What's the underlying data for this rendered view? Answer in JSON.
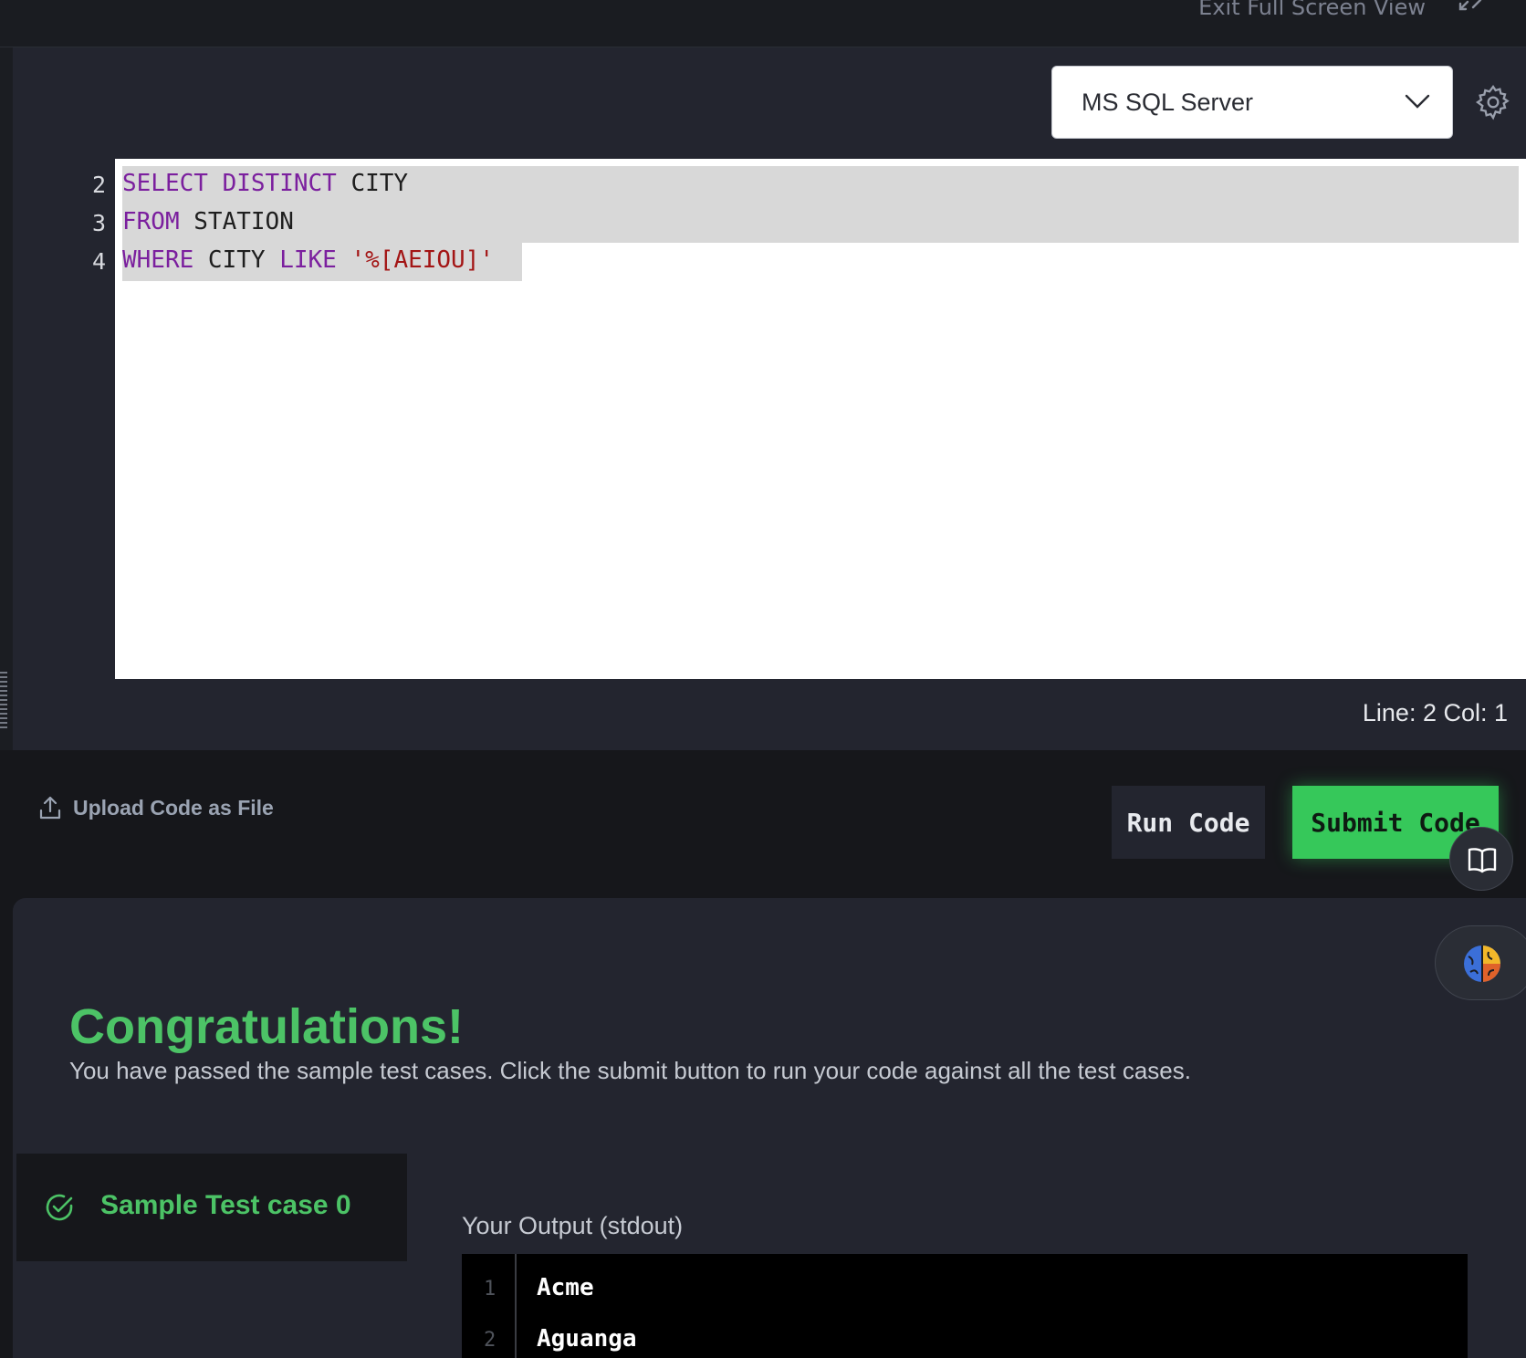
{
  "topbar": {
    "exit_fullscreen_label": "Exit Full Screen View"
  },
  "editor": {
    "language": "MS SQL Server",
    "lines": [
      {
        "number": "2",
        "tokens": [
          [
            "kw",
            "SELECT"
          ],
          [
            "t",
            " "
          ],
          [
            "kw",
            "DISTINCT"
          ],
          [
            "t",
            " CITY"
          ]
        ]
      },
      {
        "number": "3",
        "tokens": [
          [
            "kw",
            "FROM"
          ],
          [
            "t",
            " STATION"
          ]
        ]
      },
      {
        "number": "4",
        "tokens": [
          [
            "kw",
            "WHERE"
          ],
          [
            "t",
            " CITY "
          ],
          [
            "kw",
            "LIKE"
          ],
          [
            "t",
            " "
          ],
          [
            "str",
            "'%[AEIOU]'"
          ]
        ]
      }
    ],
    "status": "Line: 2 Col: 1"
  },
  "actions": {
    "upload_label": "Upload Code as File",
    "run_label": "Run Code",
    "submit_label": "Submit Code",
    "accent_color": "#36c85a"
  },
  "results": {
    "title": "Congratulations!",
    "message": "You have passed the sample test cases. Click the submit button to run your code against all the test cases.",
    "testcase_label": "Sample Test case 0",
    "output_label": "Your Output (stdout)",
    "output_lines": [
      {
        "number": "1",
        "value": "Acme"
      },
      {
        "number": "2",
        "value": "Aguanga"
      }
    ]
  }
}
